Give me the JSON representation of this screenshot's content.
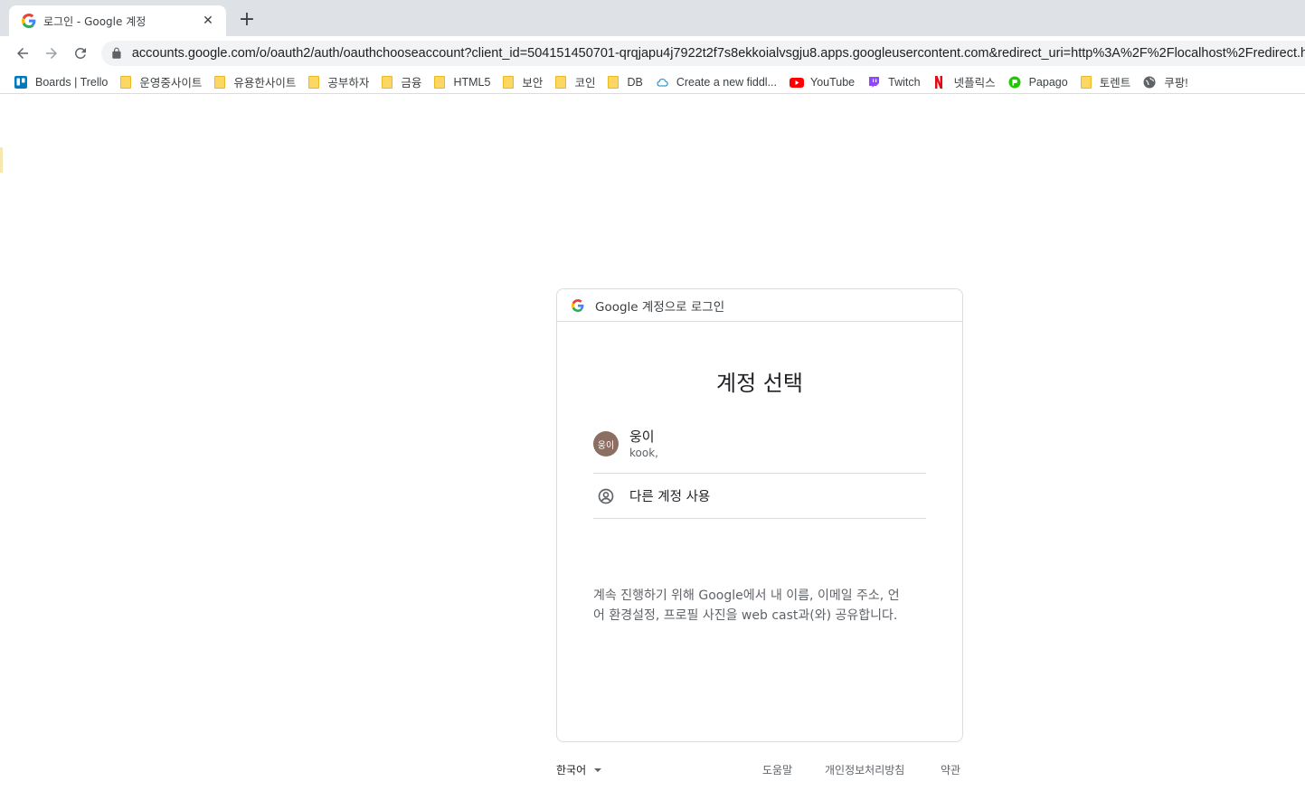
{
  "browser": {
    "tab_title": "로그인 - Google 계정",
    "tab_close": "✕",
    "new_tab": "+",
    "url": "accounts.google.com/o/oauth2/auth/oauthchooseaccount?client_id=504151450701-qrqjapu4j7922t2f7s8ekkoialvsgju8.apps.googleusercontent.com&redirect_uri=http%3A%2F%2Flocalhost%2Fredirect.h..."
  },
  "bookmarks": [
    {
      "label": "Boards | Trello",
      "icon": "trello-icon"
    },
    {
      "label": "운영중사이트",
      "icon": "folder-icon"
    },
    {
      "label": "유용한사이트",
      "icon": "folder-icon"
    },
    {
      "label": "공부하자",
      "icon": "folder-icon"
    },
    {
      "label": "금융",
      "icon": "folder-icon"
    },
    {
      "label": "HTML5",
      "icon": "folder-icon"
    },
    {
      "label": "보안",
      "icon": "folder-icon"
    },
    {
      "label": "코인",
      "icon": "folder-icon"
    },
    {
      "label": "DB",
      "icon": "folder-icon"
    },
    {
      "label": "Create a new fiddl...",
      "icon": "cloud-icon"
    },
    {
      "label": "YouTube",
      "icon": "youtube-icon"
    },
    {
      "label": "Twitch",
      "icon": "twitch-icon"
    },
    {
      "label": "넷플릭스",
      "icon": "netflix-icon"
    },
    {
      "label": "Papago",
      "icon": "papago-icon"
    },
    {
      "label": "토렌트",
      "icon": "folder-icon"
    },
    {
      "label": "쿠팡!",
      "icon": "globe-icon"
    }
  ],
  "card": {
    "header": "Google 계정으로 로그인",
    "title": "계정 선택",
    "account": {
      "avatar_text": "웅이",
      "name": "웅이",
      "email": "kook,"
    },
    "other_account": "다른 계정 사용",
    "consent_line1": "계속 진행하기 위해 Google에서 내 이름, 이메일 주소, 언",
    "consent_line2": "어 환경설정, 프로필 사진을 web cast과(와) 공유합니다."
  },
  "footer": {
    "language": "한국어",
    "help": "도움말",
    "privacy": "개인정보처리방침",
    "terms": "약관"
  },
  "colors": {
    "avatar_bg": "#8d6e63",
    "folder": "#fdd663",
    "tabstrip": "#dee1e6"
  }
}
